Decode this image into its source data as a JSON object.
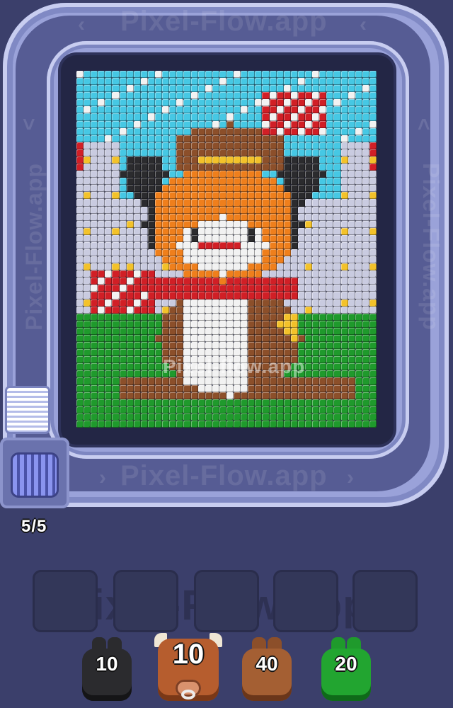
{
  "watermark": "Pixel-Flow.app",
  "watermark_center": "Pixel-flow.app",
  "progress": "5/5",
  "slots": [
    {
      "id": 1,
      "state": "empty"
    },
    {
      "id": 2,
      "state": "empty"
    },
    {
      "id": 3,
      "state": "empty"
    },
    {
      "id": 4,
      "state": "empty"
    },
    {
      "id": 5,
      "state": "empty"
    }
  ],
  "shooters": [
    {
      "color": "black",
      "hex": "#2b2b2e",
      "count": "10"
    },
    {
      "color": "bull-brown",
      "hex": "#b65d2e",
      "count": "10"
    },
    {
      "color": "brown",
      "hex": "#8c4f2a",
      "count": "40"
    },
    {
      "color": "green",
      "hex": "#1f9a2c",
      "count": "20"
    }
  ],
  "colors": {
    "background": "#3b3f6b",
    "track": "#9aa2d9",
    "sky": "#46c8e4",
    "white": "#f2f2f2",
    "red": "#d11f26",
    "yellow": "#f3c22a",
    "orange": "#ef7f1c",
    "brown": "#8c4f2a",
    "black": "#2b2b2e",
    "gray": "#c9cbe0",
    "grass": "#1f9a2c"
  },
  "icons": {
    "queue": "stacked-bars-icon",
    "launcher": "roller-icon",
    "track_arrows": "chevron-icon"
  }
}
